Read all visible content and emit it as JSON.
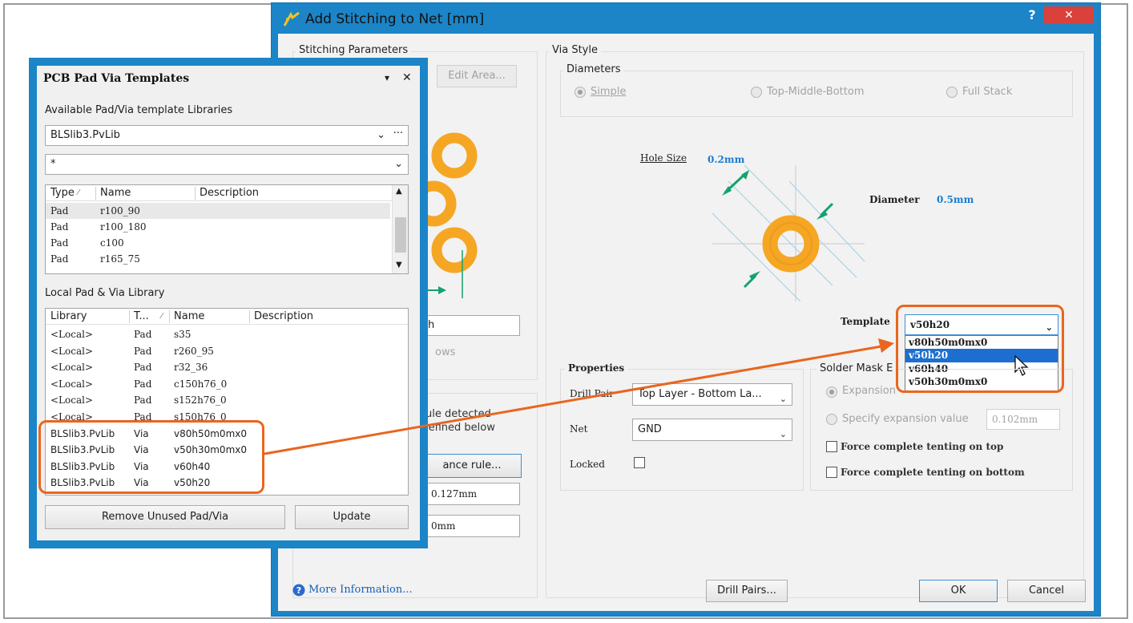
{
  "dialog": {
    "title": "Add Stitching to Net [mm]",
    "help": "?",
    "close": "✕",
    "stitching_params_label": "Stitching Parameters",
    "edit_area_label": "Edit Area...",
    "rule_detected_line1": "ule detected",
    "rule_detected_line2": "lefined below",
    "clearance_rule_label": "ance rule...",
    "clearance_value": "0.127mm",
    "offset_value": "0mm",
    "partial_field": "h",
    "partial_ows": "ows",
    "via_style_label": "Via Style",
    "diameters_label": "Diameters",
    "radio_simple": "Simple",
    "radio_tmb": "Top-Middle-Bottom",
    "radio_full": "Full Stack",
    "hole_size_label": "Hole Size",
    "hole_size_value": "0.2mm",
    "diameter_label": "Diameter",
    "diameter_value": "0.5mm",
    "template_label": "Template",
    "template_selected": "v50h20",
    "template_options": [
      "v80h50m0mx0",
      "v50h20",
      "v60h40",
      "v50h30m0mx0"
    ],
    "properties_label": "Properties",
    "drill_pair_label": "Drill Pair",
    "drill_pair_value": "Top Layer - Bottom La...",
    "net_label": "Net",
    "net_value": "GND",
    "locked_label": "Locked",
    "solder_mask_label": "Solder Mask E",
    "expansion_label": "Expansion",
    "specify_expansion_label": "Specify expansion value",
    "specify_expansion_value": "0.102mm",
    "force_top_label": "Force complete tenting on top",
    "force_bottom_label": "Force complete tenting on bottom",
    "more_info_label": "More Information...",
    "drill_pairs_label": "Drill Pairs...",
    "ok_label": "OK",
    "cancel_label": "Cancel"
  },
  "panel": {
    "title": "PCB Pad Via Templates",
    "pin": "▾",
    "close": "✕",
    "available_label": "Available Pad/Via template Libraries",
    "library_value": "BLSlib3.PvLib",
    "filter_value": "*",
    "more": "···",
    "top_headers": [
      "Type",
      "Name",
      "Description"
    ],
    "top_rows": [
      {
        "type": "Pad",
        "name": "r100_90"
      },
      {
        "type": "Pad",
        "name": "r100_180"
      },
      {
        "type": "Pad",
        "name": "c100"
      },
      {
        "type": "Pad",
        "name": "r165_75"
      }
    ],
    "local_label": "Local Pad & Via Library",
    "local_headers": [
      "Library",
      "T...",
      "Name",
      "Description"
    ],
    "local_rows": [
      {
        "library": "<Local>",
        "type": "Pad",
        "name": "s35"
      },
      {
        "library": "<Local>",
        "type": "Pad",
        "name": "r260_95"
      },
      {
        "library": "<Local>",
        "type": "Pad",
        "name": "r32_36"
      },
      {
        "library": "<Local>",
        "type": "Pad",
        "name": "c150h76_0"
      },
      {
        "library": "<Local>",
        "type": "Pad",
        "name": "s152h76_0"
      },
      {
        "library": "<Local>",
        "type": "Pad",
        "name": "s150h76_0"
      },
      {
        "library": "BLSlib3.PvLib",
        "type": "Via",
        "name": "v80h50m0mx0"
      },
      {
        "library": "BLSlib3.PvLib",
        "type": "Via",
        "name": "v50h30m0mx0"
      },
      {
        "library": "BLSlib3.PvLib",
        "type": "Via",
        "name": "v60h40"
      },
      {
        "library": "BLSlib3.PvLib",
        "type": "Via",
        "name": "v50h20"
      }
    ],
    "remove_label": "Remove Unused Pad/Via",
    "update_label": "Update"
  },
  "colors": {
    "accent": "#1b85c8",
    "callout": "#e8661f",
    "via_ring": "#f5a623",
    "arrow": "#12a36f",
    "selection": "#1c6fd0"
  }
}
